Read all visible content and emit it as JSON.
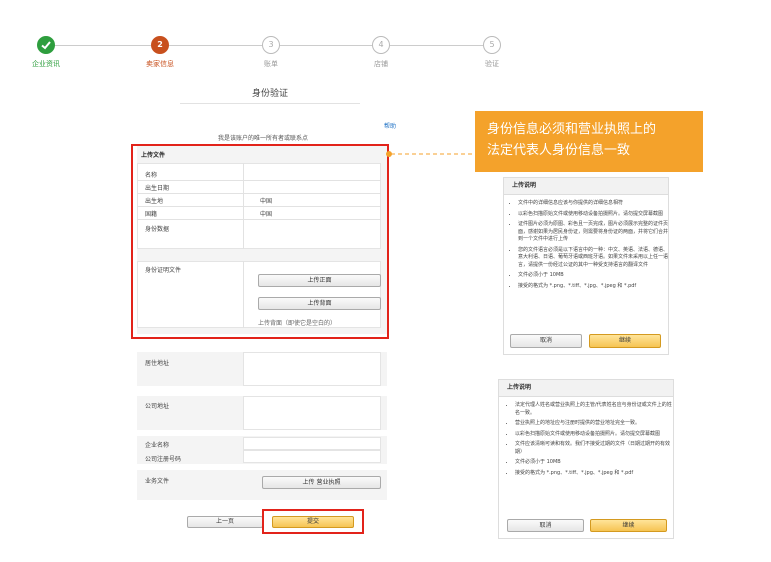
{
  "steps": [
    {
      "num": "",
      "label": "企业资讯",
      "state": "done"
    },
    {
      "num": "2",
      "label": "卖家信息",
      "state": "current"
    },
    {
      "num": "3",
      "label": "账单",
      "state": "todo"
    },
    {
      "num": "4",
      "label": "店铺",
      "state": "todo"
    },
    {
      "num": "5",
      "label": "验证",
      "state": "todo"
    }
  ],
  "page_title": "身份验证",
  "help_link": "帮助",
  "subtitle": "我是该账户的唯一所有者或联系点",
  "upload_section": {
    "title": "上传文件",
    "fields": [
      {
        "label": "名称",
        "value": ""
      },
      {
        "label": "出生日期",
        "value": ""
      },
      {
        "label": "出生地",
        "value": "中国"
      },
      {
        "label": "国籍",
        "value": "中国"
      },
      {
        "label": "身份数据",
        "value": ""
      }
    ],
    "id_doc_label": "身份证明文件",
    "upload_front": "上传正面",
    "upload_back": "上传背面",
    "back_hint": "上传背面（即使它是空白的）"
  },
  "residence_label": "居住地址",
  "company_address_label": "公司地址",
  "company_name_label": "企业名称",
  "company_reg_label": "公司注册号码",
  "business_docs_label": "业务文件",
  "upload_license": "上传 营业执照",
  "prev_button": "上一页",
  "submit_button": "提交",
  "callout": {
    "line1": "身份信息必须和营业执照上的",
    "line2": "法定代表人身份信息一致"
  },
  "panel1": {
    "title": "上传说明",
    "items": [
      "文件中的详细信息应该与你提供的详细信息相符",
      "以彩色扫描原始文件或使用移动设备拍摄照片。请勿提交屏幕截图",
      "证件图片必须为原图、彩色且一页完成，图片必须展示完整的证件页面，感谢如果为居民身份证，则需要将身份证的两面，并将它们合并到一个文件中进行上传",
      "您的文件语言必须是以下语言中的一种：中文、英语、法语、德语、意大利语、日语、葡萄牙语或西班牙语。如果文件未采用以上任一语言，请提供一份经过公证的其中一种受支持语言的翻译文件",
      "文件必须小于 10MB",
      "接受的格式为 *.png、*.tiff、*.jpg、*.jpeg 和 *.pdf"
    ],
    "cancel": "取消",
    "continue": "继续"
  },
  "panel2": {
    "title": "上传说明",
    "items": [
      "法定代理人姓名或营业执照上的主管/代表姓名应与身份证或文件上的姓名一致。",
      "营业执照上的地址应与注册时提供的营业地址完全一致。",
      "以彩色扫描原始文件或使用移动设备拍摄照片。请勿提交屏幕截图",
      "文件应该清晰可读和有效。我们不接受过期的文件（日期过期开的有效期）",
      "文件必须小于 10MB",
      "接受的格式为 *.png、*.tiff、*.jpg、*.jpeg 和 *.pdf"
    ],
    "cancel": "取消",
    "continue": "继续"
  },
  "colors": {
    "done": "#2e9e3e",
    "current": "#c8501e",
    "highlight": "#e2231a",
    "callout": "#f4a22b",
    "button_yellow": "#f6c453"
  }
}
